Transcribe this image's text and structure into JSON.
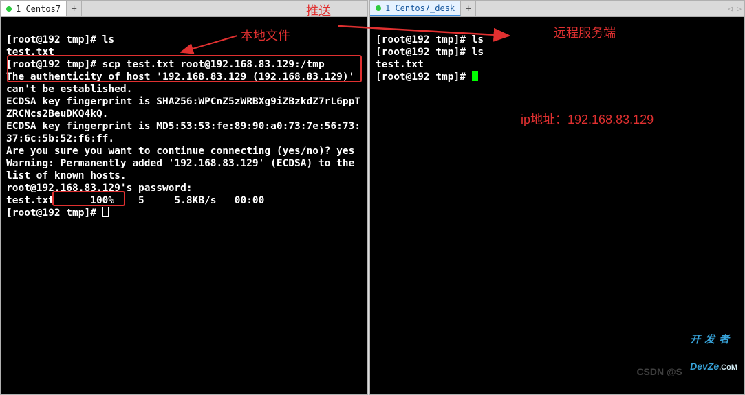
{
  "left_pane": {
    "tab": {
      "name": "1 Centos7",
      "add": "+"
    },
    "terminal": {
      "line1": "[root@192 tmp]# ls",
      "line2": "test.txt",
      "line3": "[root@192 tmp]# scp test.txt root@192.168.83.129:/tmp",
      "line4": "The authenticity of host '192.168.83.129 (192.168.83.129)' can't be established.",
      "line5": "ECDSA key fingerprint is SHA256:WPCnZ5zWRBXg9iZBzkdZ7rL6ppTZRCNcs2BeuDKQ4kQ.",
      "line6": "ECDSA key fingerprint is MD5:53:53:fe:89:90:a0:73:7e:56:73:37:6c:5b:52:f6:ff.",
      "line7": "Are you sure you want to continue connecting (yes/no)? yes",
      "line8": "Warning: Permanently added '192.168.83.129' (ECDSA) to the list of known hosts.",
      "line9": "root@192.168.83.129's password:",
      "line10": "test.txt      100%    5     5.8KB/s   00:00",
      "line11": "[root@192 tmp]# "
    }
  },
  "right_pane": {
    "tab": {
      "name": "1 Centos7_desk",
      "add": "+",
      "nav": "◁ ▷"
    },
    "terminal": {
      "line1": "[root@192 tmp]# ls",
      "line2": "[root@192 tmp]# ls",
      "line3": "test.txt",
      "line4": "[root@192 tmp]# "
    }
  },
  "annotations": {
    "local_file": "本地文件",
    "push": "推送",
    "remote_server": "远程服务端",
    "ip_label": "ip地址：192.168.83.129"
  },
  "watermarks": {
    "csdn": "CSDN @S",
    "devze_top": "开发者",
    "devze_bottom_a": "DevZe",
    "devze_bottom_b": ".CoM"
  }
}
